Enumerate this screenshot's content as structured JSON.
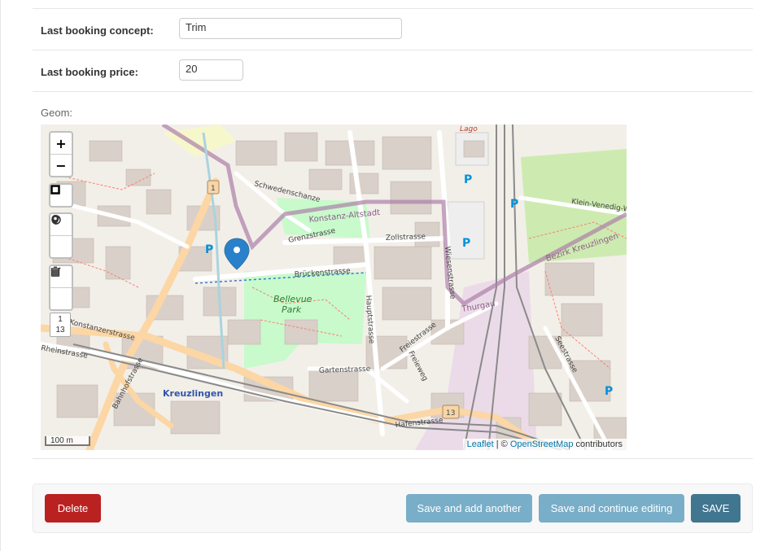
{
  "form": {
    "concept": {
      "label": "Last booking concept:",
      "value": "Trim"
    },
    "price": {
      "label": "Last booking price:",
      "value": "20"
    },
    "geom_label": "Geom:"
  },
  "map": {
    "controls": {
      "zoom_in": "+",
      "zoom_out": "−",
      "zoom_level_top": "1",
      "zoom_level_bottom": "13"
    },
    "scale": "100 m",
    "attribution": {
      "leaflet": "Leaflet",
      "sep": " | © ",
      "osm": "OpenStreetMap",
      "suffix": " contributors"
    },
    "labels": {
      "lago": "Lago",
      "konstanz_altstadt": "Konstanz-Altstadt",
      "bellevue": "Bellevue",
      "park": "Park",
      "kreuzlingen": "Kreuzlingen",
      "bezirk": "Bezirk Kreuzlingen",
      "klein_venedig": "Klein-Venedig-W",
      "konstanzerstrasse": "Konstanzerstrasse",
      "brueckenstrasse": "Brückenstrasse",
      "zollstrasse": "Zollstrasse",
      "grenzstrasse": "Grenzstrasse",
      "schwedenschanze": "Schwedenschanze",
      "gartenstrasse": "Gartenstrasse",
      "hafenstrasse": "Hafenstrasse",
      "hauptstrasse": "Hauptstrasse",
      "wiesenstrasse": "Wiesenstrasse",
      "rheinstrasse": "Rheinstrasse",
      "bahnhofstrasse": "Bahnhofstrasse",
      "seestrasse": "Seestrasse",
      "thurgau": "Thurgau",
      "freiestrasse": "Freiestrasse",
      "freieweg": "Freieweg",
      "route1": "1",
      "route13": "13"
    }
  },
  "actions": {
    "delete": "Delete",
    "save_add": "Save and add another",
    "save_continue": "Save and continue editing",
    "save": "SAVE"
  },
  "colors": {
    "delete": "#ba2121",
    "secondary": "#79aec8",
    "primary": "#417690",
    "marker": "#2a81cb"
  }
}
